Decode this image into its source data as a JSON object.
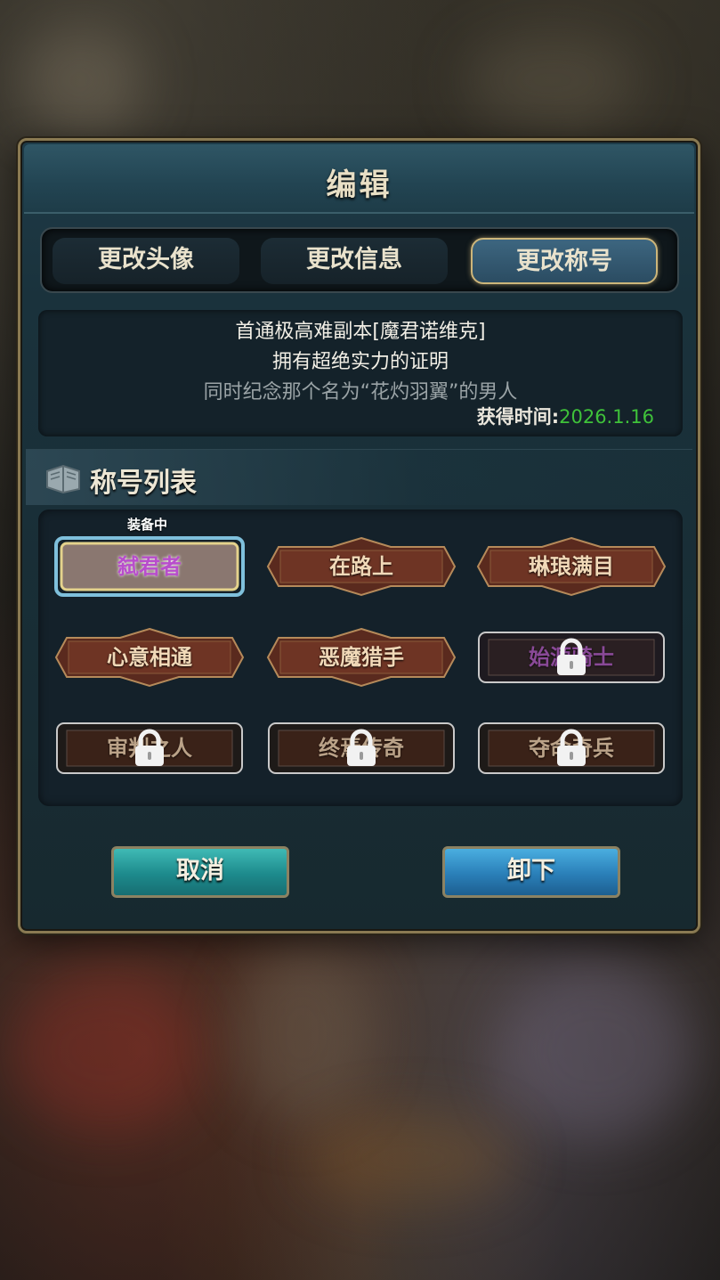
{
  "dialog": {
    "title": "编辑"
  },
  "tabs": [
    {
      "label": "更改头像",
      "active": false
    },
    {
      "label": "更改信息",
      "active": false
    },
    {
      "label": "更改称号",
      "active": true
    }
  ],
  "description": {
    "line1": "首通极高难副本[魔君诺维克]",
    "line2": "拥有超绝实力的证明",
    "line3": "同时纪念那个名为“花灼羽翼”的男人",
    "acquired_label": "获得时间:",
    "acquired_date": "2026.1.16"
  },
  "title_list": {
    "header": "称号列表",
    "equipped_tag": "装备中",
    "items": [
      {
        "label": "弑君者",
        "equipped": true,
        "locked": false
      },
      {
        "label": "在路上",
        "equipped": false,
        "locked": false
      },
      {
        "label": "琳琅满目",
        "equipped": false,
        "locked": false
      },
      {
        "label": "心意相通",
        "equipped": false,
        "locked": false
      },
      {
        "label": "恶魔猎手",
        "equipped": false,
        "locked": false
      },
      {
        "label": "始源骑士",
        "equipped": false,
        "locked": true
      },
      {
        "label": "审判之人",
        "equipped": false,
        "locked": true
      },
      {
        "label": "终焉传奇",
        "equipped": false,
        "locked": true
      },
      {
        "label": "夺命奇兵",
        "equipped": false,
        "locked": true
      }
    ]
  },
  "buttons": {
    "cancel": "取消",
    "unequip": "卸下"
  },
  "colors": {
    "acquired_date": "#3fc23a",
    "equipped_text": "#b84dcc",
    "accent_gold": "#cdb67a"
  }
}
